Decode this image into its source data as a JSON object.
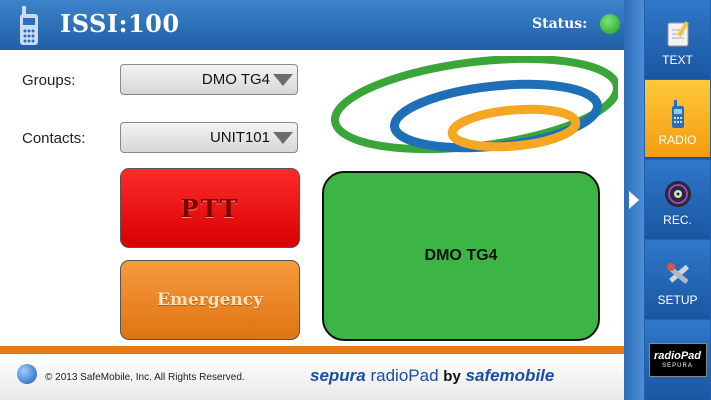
{
  "header": {
    "title": "ISSI:100",
    "status_label": "Status:"
  },
  "form": {
    "groups_label": "Groups:",
    "groups_value": "DMO TG4",
    "contacts_label": "Contacts:",
    "contacts_value": "UNIT101"
  },
  "buttons": {
    "ptt_label": "PTT",
    "emergency_label": "Emergency"
  },
  "channel": {
    "display": "DMO TG4"
  },
  "footer": {
    "copyright": "© 2013 SafeMobile, Inc. All Rights Reserved.",
    "brand_sepura": "sepura",
    "brand_radiopad": "radioPad",
    "brand_by": "by",
    "brand_safemobile": "safemobile"
  },
  "sidebar": {
    "items": [
      {
        "label": "TEXT",
        "icon": "notepad-icon"
      },
      {
        "label": "RADIO",
        "icon": "radio-icon",
        "active": true
      },
      {
        "label": "REC.",
        "icon": "disc-icon"
      },
      {
        "label": "SETUP",
        "icon": "tools-icon"
      }
    ],
    "logo_top": "radioPad",
    "logo_bottom": "SEPURA"
  },
  "colors": {
    "header_blue": "#2a6fb9",
    "status_green": "#2faa2b",
    "ptt_red": "#e00000",
    "emergency_orange": "#ec8424",
    "channel_green": "#3cb544",
    "radio_active": "#f5a623"
  }
}
